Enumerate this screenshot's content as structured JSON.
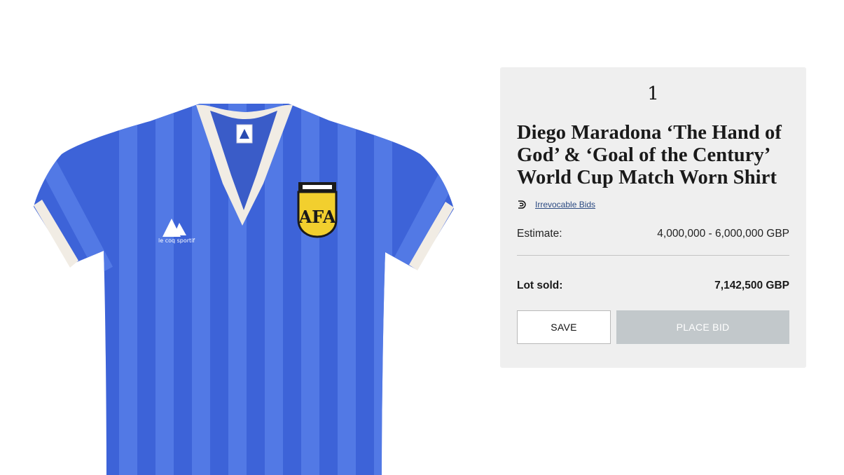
{
  "image": {
    "alt_icon": "shirt-image",
    "colors": {
      "shirt": "#3d63d8",
      "stripe": "#5a80ea",
      "collar": "#f1ece4",
      "badge": "#f2cf2e"
    },
    "badge_text": "AFA",
    "brand_text": "le coq sportif"
  },
  "lot": {
    "number": "1",
    "title": "Diego Maradona ‘The Hand of God’ & ‘Goal of the Century’ World Cup Match Worn Shirt",
    "bids_icon": "irrevocable-bids-icon",
    "bids_label": "Irrevocable Bids",
    "estimate_label": "Estimate:",
    "estimate_value": "4,000,000 - 6,000,000 GBP",
    "sold_label": "Lot sold:",
    "sold_value": "7,142,500 GBP",
    "save_label": "SAVE",
    "place_bid_label": "PLACE BID"
  },
  "colors": {
    "panel_bg": "#efefef",
    "link": "#2b4a82",
    "place_bid_bg": "#c2c8cb"
  }
}
